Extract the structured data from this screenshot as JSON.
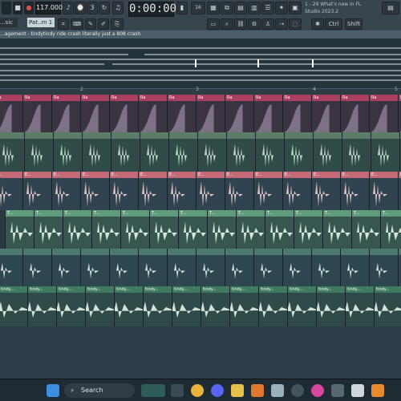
{
  "toolbar": {
    "tempo": "117.000",
    "time": "0:00:00",
    "pattern": "Pat..rn 1",
    "mode": "...sic",
    "hint_line1": "1 - 29   What's new in FL",
    "hint_line2": "Studio 2023.2",
    "mini_labels": [
      "Ctrl",
      "Shift"
    ],
    "counter": "16"
  },
  "title": "...agement - tindytindy ride crash literally just a 808 crash",
  "ruler": [
    "2",
    "3",
    "4",
    "5"
  ],
  "tracks": [
    {
      "label": "Ra",
      "color": "#a9405f",
      "type": "env"
    },
    {
      "label": "",
      "color": "#5a7d66",
      "type": "hit"
    },
    {
      "label": "E...",
      "color": "#c56b76",
      "type": "pink"
    },
    {
      "label": "T...",
      "color": "#5f9c7a",
      "type": "short"
    },
    {
      "label": "",
      "color": "#4d7a70",
      "type": "tick"
    },
    {
      "label": "tindy...",
      "color": "#3f7b5f",
      "type": "long"
    }
  ],
  "taskbar": {
    "search_label": "Search"
  }
}
